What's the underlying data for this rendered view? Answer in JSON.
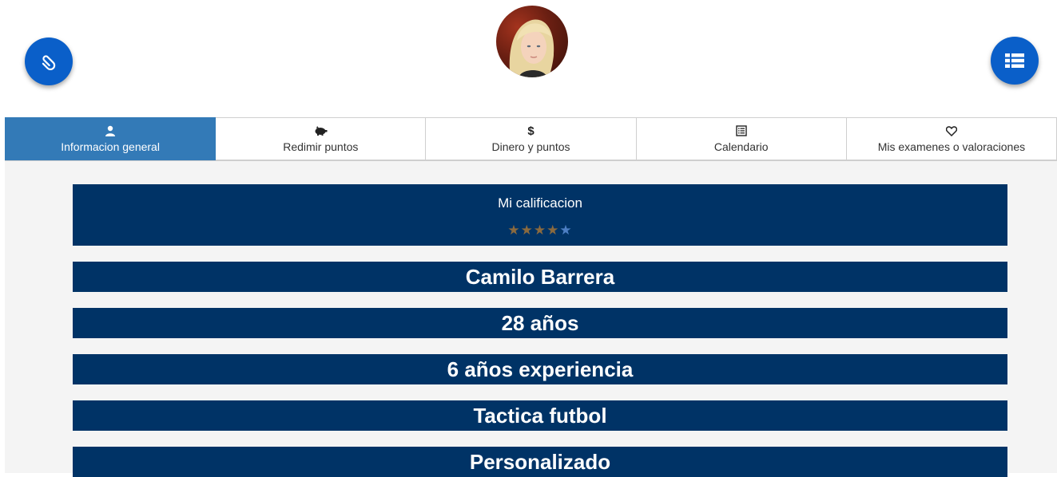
{
  "header": {
    "left_button_icon": "paperclip-icon",
    "right_button_icon": "list-icon",
    "avatar": "profile-photo"
  },
  "tabs": [
    {
      "label": "Informacion general",
      "icon": "user-icon",
      "active": true
    },
    {
      "label": "Redimir puntos",
      "icon": "piggy-bank-icon",
      "active": false
    },
    {
      "label": "Dinero y puntos",
      "icon": "dollar-icon",
      "active": false
    },
    {
      "label": "Calendario",
      "icon": "list-alt-icon",
      "active": false
    },
    {
      "label": "Mis examenes o valoraciones",
      "icon": "heart-icon",
      "active": false
    }
  ],
  "rating": {
    "title": "Mi calificacion",
    "stars_filled": 4,
    "stars_total": 5,
    "star_glyph": "★"
  },
  "info": {
    "name": "Camilo Barrera",
    "age": "28 años",
    "experience": "6 años experiencia",
    "specialty": "Tactica futbol",
    "type": "Personalizado"
  },
  "colors": {
    "accent": "#0a5fc9",
    "active_tab": "#337ab7",
    "card": "#003366",
    "panel_bg": "#f4f4f4",
    "star_filled": "#8a6a3f",
    "star_empty": "#4d7fc4"
  }
}
